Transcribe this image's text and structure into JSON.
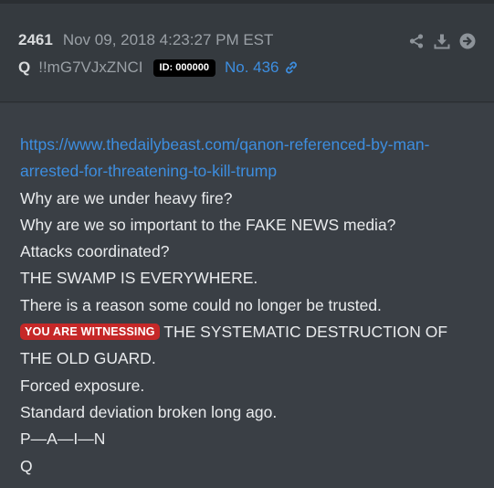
{
  "post": {
    "number": "2461",
    "date": "Nov 09, 2018 4:23:27 PM EST",
    "author": "Q",
    "tripcode": "!!mG7VJxZNCI",
    "id_badge": "ID: 000000",
    "post_link": "No. 436"
  },
  "icons": {
    "share": "share-icon",
    "download": "download-icon",
    "next": "arrow-right-circle-icon",
    "link": "chain-link-icon"
  },
  "colors": {
    "background": "#353a3f",
    "body_background": "#3a3f45",
    "link": "#3d8ee0",
    "highlight": "#c62828"
  },
  "body": {
    "url": "https://www.thedailybeast.com/qanon-referenced-by-man-arrested-for-threatening-to-kill-trump",
    "lines": [
      "Why are we under heavy fire?",
      "Why are we so important to the FAKE NEWS media?",
      "Attacks coordinated?",
      "THE SWAMP IS EVERYWHERE.",
      "There is a reason some could no longer be trusted."
    ],
    "highlight": "YOU ARE WITNESSING",
    "highlight_rest": " THE SYSTEMATIC DESTRUCTION OF THE OLD GUARD.",
    "tail_lines": [
      "Forced exposure.",
      "Standard deviation broken long ago.",
      "P—A—I—N",
      "Q"
    ]
  }
}
